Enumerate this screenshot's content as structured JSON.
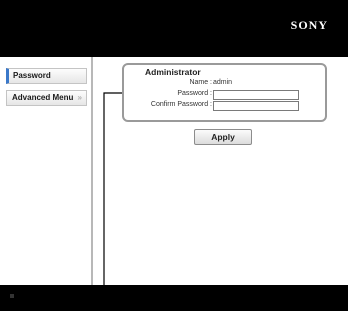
{
  "header": {
    "brand": "SONY"
  },
  "sidebar": {
    "items": [
      {
        "label": "Password",
        "active": true
      },
      {
        "label": "Advanced Menu",
        "chevron": "»"
      }
    ]
  },
  "admin": {
    "title": "Administrator",
    "name_label": "Name :",
    "name_value": "admin",
    "password_label": "Password :",
    "password_value": "",
    "confirm_label": "Confirm Password :",
    "confirm_value": ""
  },
  "actions": {
    "apply_label": "Apply"
  },
  "colors": {
    "header_bg": "#000000",
    "footer_bg": "#000000",
    "active_accent": "#3a78c9",
    "panel_border": "#9a9a9a"
  }
}
